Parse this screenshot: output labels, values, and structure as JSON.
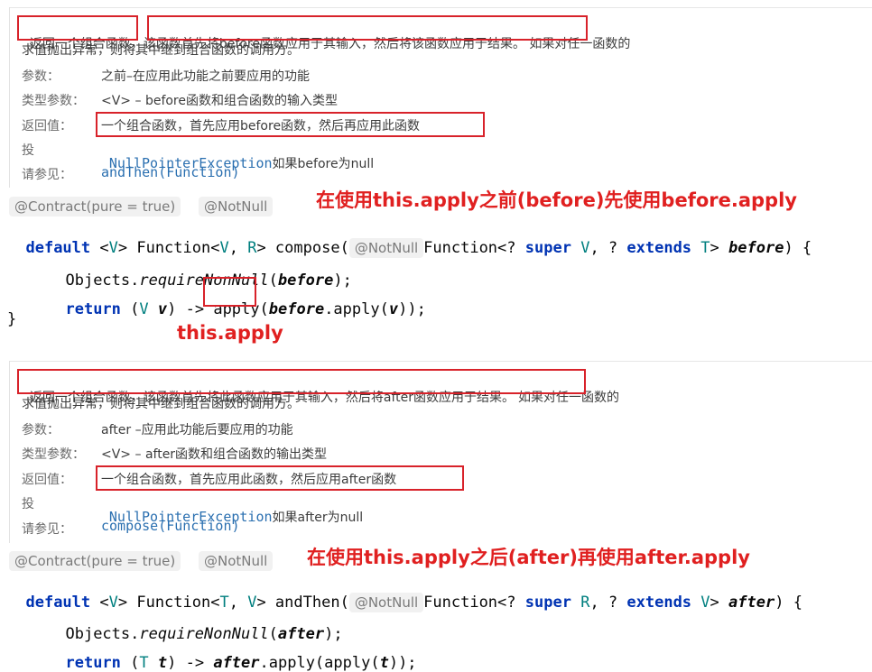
{
  "compose_doc": {
    "p1": "返回一个组合函数",
    "p2": "，",
    "p3": "该函数首先将before函数应用于其输入，然后将该函数应用于结果。",
    "p4": " 如果对任一函数的",
    "line2": "求值抛出异常，则将其中继到组合函数的调用方。",
    "param_label": "参数：",
    "param_value": "之前–在应用此功能之前要应用的功能",
    "type_label": "类型参数：",
    "type_value": "<V> – before函数和组合函数的输入类型",
    "return_label": "返回值：",
    "return_value": "一个组合函数，首先应用before函数，然后再应用此函数",
    "throws_label": "投",
    "throws_exc": "NullPointerException",
    "throws_value": "如果before为null",
    "see_label": "请参见：",
    "see_value": "andThen(Function)"
  },
  "compose_code": {
    "anno_contract": "@Contract(pure = true)",
    "anno_notnull": "@NotNull",
    "note": "在使用this.apply之前(before)先使用before.apply",
    "sig": {
      "default": "default",
      "t1": " <",
      "v1": "V",
      "t2": "> Function<",
      "v2": "V",
      "t3": ", ",
      "r1": "R",
      "t4": "> compose(",
      "notnull": "@NotNull",
      "t5": "Function<? ",
      "super": "super",
      "t6": " ",
      "v3": "V",
      "t7": ", ? ",
      "extends": "extends",
      "t8": " ",
      "tT": "T",
      "t9": "> ",
      "param": "before",
      "t10": ") {"
    },
    "line1": {
      "a": "Objects.",
      "b": "requireNonNull",
      "c": "(",
      "d": "before",
      "e": ");"
    },
    "line2": {
      "ret": "return",
      "a": " (",
      "v": "V",
      "b": " ",
      "vv": "v",
      "c": ") -> ",
      "apply": "apply",
      "d": "(",
      "e": "before",
      "f": ".apply(",
      "g": "v",
      "h": "));"
    },
    "close": "}",
    "note2": "this.apply"
  },
  "andthen_doc": {
    "p1": "返回一个组合函数，该函数首先将此函数应用于其输入，然后将after函数应用于结果。",
    "p2": "如果对任一函数的",
    "line2": "求值抛出异常，则将其中继到组合函数的调用方。",
    "param_label": "参数：",
    "param_value": "after –应用此功能后要应用的功能",
    "type_label": "类型参数：",
    "type_value": "<V> – after函数和组合函数的输出类型",
    "return_label": "返回值：",
    "return_value": "一个组合函数，首先应用此函数，然后应用after函数",
    "throws_label": "投",
    "throws_exc": "NullPointerException",
    "throws_value": "如果after为null",
    "see_label": "请参见：",
    "see_value": "compose(Function)"
  },
  "andthen_code": {
    "anno_contract": "@Contract(pure = true)",
    "anno_notnull": "@NotNull",
    "note": "在使用this.apply之后(after)再使用after.apply",
    "sig": {
      "default": "default",
      "t1": " <",
      "v1": "V",
      "t2": "> Function<",
      "tT": "T",
      "t3": ", ",
      "v2": "V",
      "t4": "> andThen(",
      "notnull": "@NotNull",
      "t5": "Function<? ",
      "super": "super",
      "t6": " ",
      "r1": "R",
      "t7": ", ? ",
      "extends": "extends",
      "t8": " ",
      "v3": "V",
      "t9": "> ",
      "param": "after",
      "t10": ") {"
    },
    "line1": {
      "a": "Objects.",
      "b": "requireNonNull",
      "c": "(",
      "d": "after",
      "e": ");"
    },
    "line2": {
      "ret": "return",
      "a": " (",
      "t": "T",
      "b": " ",
      "tt": "t",
      "c": ") -> ",
      "after": "after",
      "d": ".apply(apply(",
      "e": "t",
      "f": "));"
    }
  }
}
